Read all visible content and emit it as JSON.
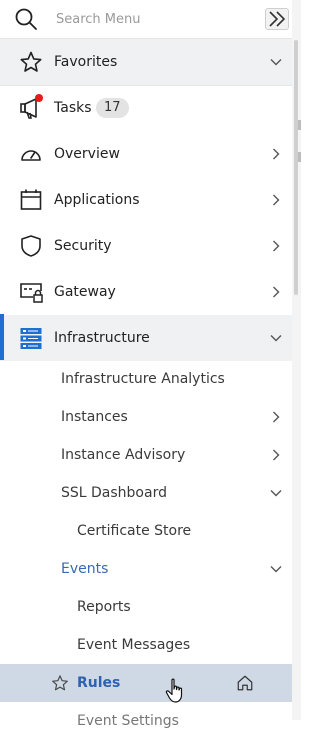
{
  "search": {
    "placeholder": "Search Menu"
  },
  "menu": {
    "favorites": {
      "label": "Favorites",
      "icon": "star-icon"
    },
    "tasks": {
      "label": "Tasks",
      "badge": "17",
      "icon": "megaphone-icon",
      "notification_color": "#e41b17"
    },
    "overview": {
      "label": "Overview",
      "icon": "gauge-icon"
    },
    "applications": {
      "label": "Applications",
      "icon": "calendar-window-icon"
    },
    "security": {
      "label": "Security",
      "icon": "shield-icon"
    },
    "gateway": {
      "label": "Gateway",
      "icon": "gateway-lock-icon"
    },
    "infrastructure": {
      "label": "Infrastructure",
      "icon": "server-stack-icon",
      "children": {
        "analytics": "Infrastructure Analytics",
        "instances": "Instances",
        "advisory": "Instance Advisory",
        "ssl": {
          "label": "SSL Dashboard",
          "children": {
            "cert_store": "Certificate Store"
          }
        },
        "events": {
          "label": "Events",
          "children": {
            "reports": "Reports",
            "event_messages": "Event Messages",
            "rules": "Rules",
            "event_settings": "Event Settings"
          }
        }
      }
    }
  },
  "colors": {
    "accent": "#1f6fd1",
    "active_row": "#cfd9e6",
    "link_blue": "#3a67b8"
  }
}
